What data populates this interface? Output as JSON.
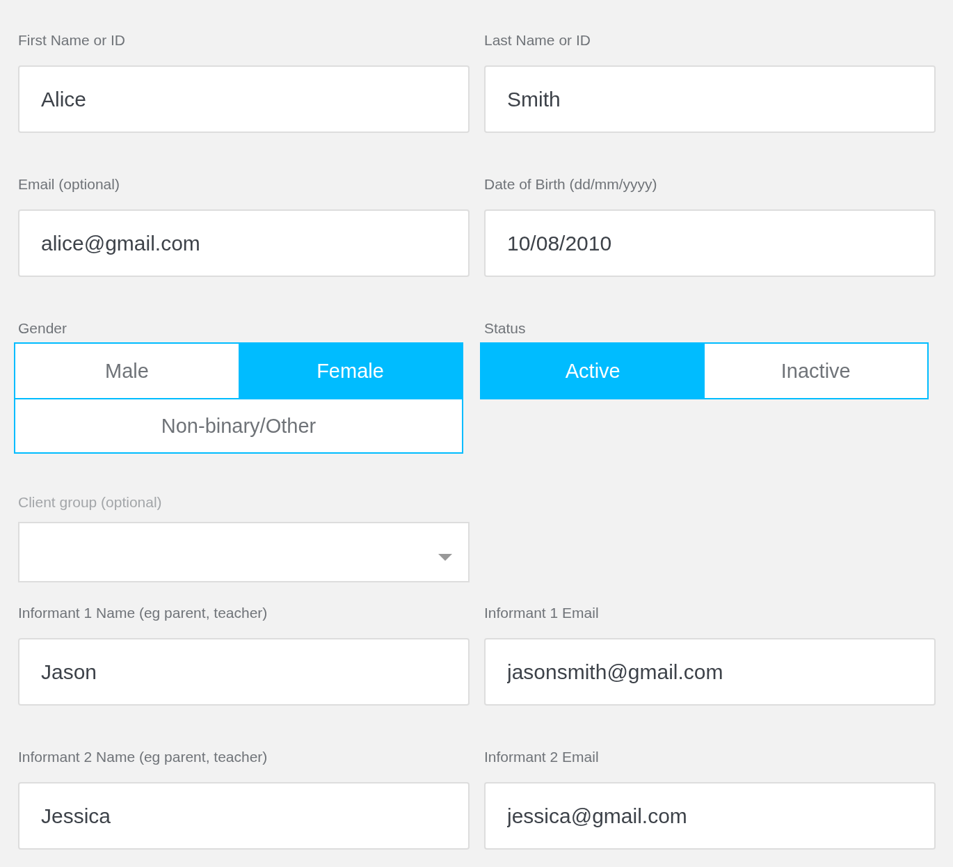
{
  "fields_top": [
    {
      "label": "First Name or ID",
      "value": "Alice"
    },
    {
      "label": "Last Name or ID",
      "value": "Smith"
    },
    {
      "label": "Email (optional)",
      "value": "alice@gmail.com"
    },
    {
      "label": "Date of Birth (dd/mm/yyyy)",
      "value": "10/08/2010"
    }
  ],
  "gender": {
    "label": "Gender",
    "options": [
      {
        "label": "Male",
        "selected": false
      },
      {
        "label": "Female",
        "selected": true
      },
      {
        "label": "Non-binary/Other",
        "selected": false
      }
    ]
  },
  "status": {
    "label": "Status",
    "options": [
      {
        "label": "Active",
        "selected": true
      },
      {
        "label": "Inactive",
        "selected": false
      }
    ]
  },
  "client_group": {
    "label": "Client group (optional)",
    "disabled": true
  },
  "fields_bottom": [
    {
      "label": "Informant 1 Name (eg parent, teacher)",
      "value": "Jason"
    },
    {
      "label": "Informant 1 Email",
      "value": "jasonsmith@gmail.com"
    },
    {
      "label": "Informant 2 Name (eg parent, teacher)",
      "value": "Jessica"
    },
    {
      "label": "Informant 2 Email",
      "value": "jessica@gmail.com"
    }
  ]
}
